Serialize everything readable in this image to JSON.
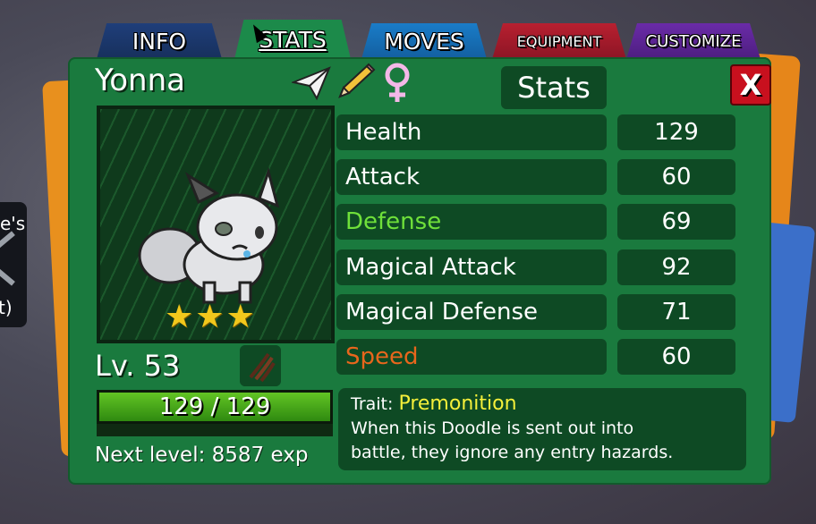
{
  "tabs": {
    "info": "INFO",
    "stats": "STATS",
    "moves": "MOVES",
    "equipment": "EQUIPMENT",
    "customize": "CUSTOMIZE"
  },
  "side_panel": {
    "line1": "e's",
    "line2": "t)"
  },
  "doodle": {
    "name": "Yonna",
    "level_text": "Lv. 53",
    "stars": "★★★",
    "hp_text": "129 / 129",
    "hp_fraction": 1.0,
    "next_level_text": "Next level: 8587 exp"
  },
  "panel": {
    "title": "Stats",
    "close_label": "X"
  },
  "stats": [
    {
      "label": "Health",
      "value": "129",
      "color": "#ffffff"
    },
    {
      "label": "Attack",
      "value": "60",
      "color": "#ffffff"
    },
    {
      "label": "Defense",
      "value": "69",
      "color": "#6fe03a"
    },
    {
      "label": "Magical Attack",
      "value": "92",
      "color": "#ffffff"
    },
    {
      "label": "Magical Defense",
      "value": "71",
      "color": "#ffffff"
    },
    {
      "label": "Speed",
      "value": "60",
      "color": "#e8661c"
    }
  ],
  "trait": {
    "prefix": "Trait:",
    "name": "Premonition",
    "line1": "When this Doodle is sent out into",
    "line2": "battle, they ignore any entry hazards."
  },
  "colors": {
    "panel_green": "#1a7a3e",
    "box_green": "#0e4a24",
    "close_red": "#c8101e",
    "trait_yellow": "#f5f03a"
  }
}
